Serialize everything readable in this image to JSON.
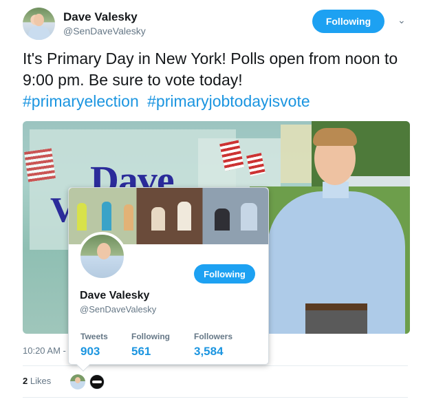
{
  "tweet": {
    "author": {
      "display_name": "Dave Valesky",
      "screen_name": "@SenDaveValesky"
    },
    "follow_button_label": "Following",
    "menu_icon": "chevron-down-icon",
    "text_line": "It's Primary Day in New York! Polls open from noon to 9:00 pm. Be sure to vote today!",
    "hashtags": [
      "#primaryelection",
      "#primaryjobtodayisvote"
    ],
    "media": {
      "logo_text_1": "Dave",
      "logo_text_2": "V"
    },
    "time": "10:20 AM -",
    "likes_count": "2",
    "likes_label": "Likes"
  },
  "hover_card": {
    "display_name": "Dave Valesky",
    "screen_name": "@SenDaveValesky",
    "follow_button_label": "Following",
    "stats": [
      {
        "label": "Tweets",
        "value": "903"
      },
      {
        "label": "Following",
        "value": "561"
      },
      {
        "label": "Followers",
        "value": "3,584"
      }
    ]
  },
  "colors": {
    "brand_blue": "#1da1f2",
    "link_blue": "#1b95e0",
    "muted": "#657786",
    "text": "#14171a"
  }
}
